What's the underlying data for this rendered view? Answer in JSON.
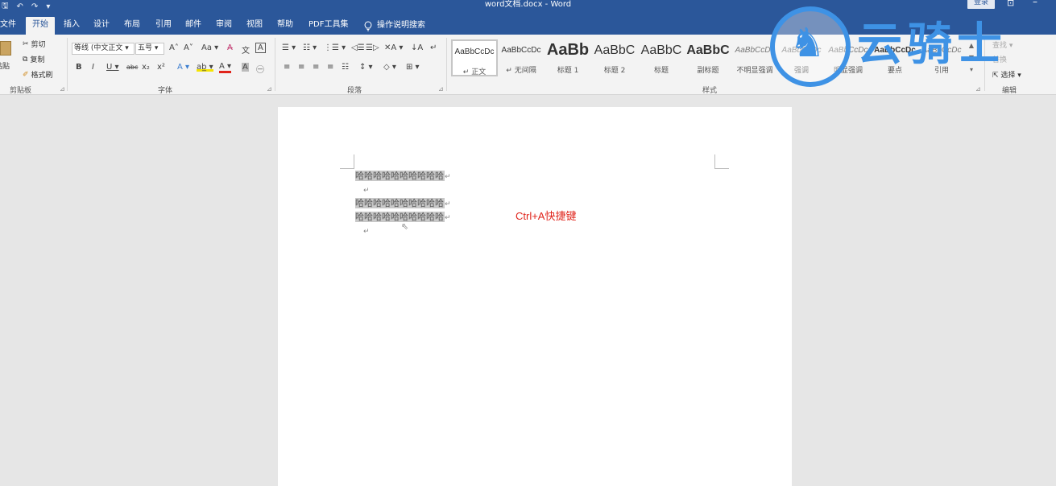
{
  "titlebar": {
    "qat": [
      "🖫",
      "↶",
      "↷",
      "▾"
    ],
    "title": "word文档.docx - Word",
    "login": "登录",
    "ribbon_options": "⊡",
    "minimize": "–"
  },
  "tabs": [
    {
      "label": "文件",
      "active": false
    },
    {
      "label": "开始",
      "active": true
    },
    {
      "label": "插入",
      "active": false
    },
    {
      "label": "设计",
      "active": false
    },
    {
      "label": "布局",
      "active": false
    },
    {
      "label": "引用",
      "active": false
    },
    {
      "label": "邮件",
      "active": false
    },
    {
      "label": "审阅",
      "active": false
    },
    {
      "label": "视图",
      "active": false
    },
    {
      "label": "帮助",
      "active": false
    },
    {
      "label": "PDF工具集",
      "active": false
    }
  ],
  "tell_me": {
    "icon": "lightbulb-icon",
    "label": "操作说明搜索"
  },
  "clipboard": {
    "paste": "粘贴",
    "cut": "剪切",
    "copy": "复制",
    "format_painter": "格式刷",
    "label": "剪贴板"
  },
  "font": {
    "family": "等线 (中文正文",
    "size": "五号",
    "label": "字体",
    "row1": [
      "A˄",
      "A˅",
      "Aa ▾",
      "A̶",
      "文",
      "A"
    ],
    "row2": [
      "B",
      "I",
      "U ▾",
      "abc",
      "x₂",
      "x²",
      "A ▾",
      "ab̲ ▾",
      "A ▾",
      "A",
      "㊀"
    ]
  },
  "paragraph": {
    "label": "段落",
    "row1": [
      "☰ ▾",
      "☷ ▾",
      "⋮☰ ▾",
      "◁☰",
      "☰▷",
      "✕A ▾",
      "↓A",
      "↵"
    ],
    "row2": [
      "≡",
      "≡",
      "≡",
      "≡",
      "☷",
      "↕ ▾",
      "◇ ▾",
      "⊞ ▾"
    ]
  },
  "styles": {
    "label": "样式",
    "items": [
      {
        "sample": "AaBbCcDc",
        "name": "↵ 正文",
        "size": 10,
        "bold": false,
        "italic": false,
        "selected": true
      },
      {
        "sample": "AaBbCcDc",
        "name": "↵ 无间隔",
        "size": 10,
        "bold": false,
        "italic": false,
        "selected": false
      },
      {
        "sample": "AaBb",
        "name": "标题 1",
        "size": 20,
        "bold": true,
        "italic": false,
        "selected": false
      },
      {
        "sample": "AaBbC",
        "name": "标题 2",
        "size": 16,
        "bold": false,
        "italic": false,
        "selected": false
      },
      {
        "sample": "AaBbC",
        "name": "标题",
        "size": 16,
        "bold": false,
        "italic": false,
        "selected": false
      },
      {
        "sample": "AaBbC",
        "name": "副标题",
        "size": 16,
        "bold": true,
        "italic": false,
        "selected": false
      },
      {
        "sample": "AaBbCcDc",
        "name": "不明显强调",
        "size": 10,
        "bold": false,
        "italic": true,
        "selected": false
      },
      {
        "sample": "AaBbCcDc",
        "name": "强调",
        "size": 10,
        "bold": false,
        "italic": true,
        "selected": false
      },
      {
        "sample": "AaBbCcDc",
        "name": "明显强调",
        "size": 10,
        "bold": false,
        "italic": true,
        "selected": false
      },
      {
        "sample": "AaBbCcDc",
        "name": "要点",
        "size": 10,
        "bold": true,
        "italic": false,
        "selected": false
      },
      {
        "sample": "AaBbCcDc",
        "name": "引用",
        "size": 10,
        "bold": false,
        "italic": true,
        "selected": false
      }
    ]
  },
  "editing": {
    "find": "查找 ▾",
    "replace": "替换",
    "select": "选择 ▾",
    "label": "编辑"
  },
  "document": {
    "lines": [
      {
        "text": "哈哈哈哈哈哈哈哈哈哈",
        "mark": "↵"
      },
      {
        "text": "",
        "mark": "↵"
      },
      {
        "text": "哈哈哈哈哈哈哈哈哈哈",
        "mark": "↵"
      },
      {
        "text": "哈哈哈哈哈哈哈哈哈哈",
        "mark": "↵"
      },
      {
        "text": "",
        "mark": "↵"
      }
    ],
    "annotation": "Ctrl+A快捷键",
    "annotation_color": "#e0241b"
  },
  "watermark": {
    "text": "云骑士",
    "color": "#3e92e5"
  },
  "colors": {
    "accent": "#2b579a",
    "ribbon_bg": "#f3f3f3",
    "canvas_bg": "#e6e6e6",
    "selection": "#c8c8c8"
  }
}
